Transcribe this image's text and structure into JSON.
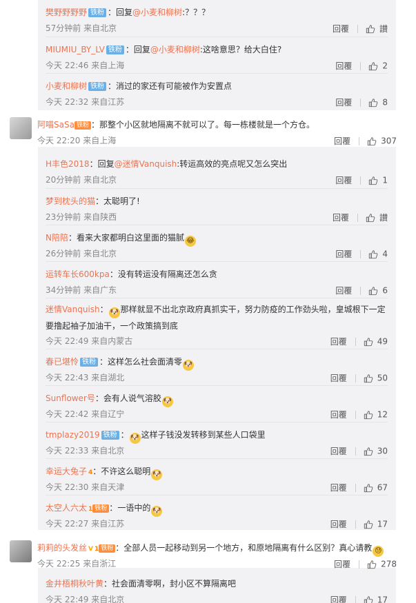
{
  "replies_top": [
    {
      "user": "樊野野野野",
      "badge": "铁粉",
      "sep": "：",
      "text_pre": "回复",
      "at": "@小麦和柳树",
      "text": ":？？？",
      "time": "57分钟前 来自北京",
      "reply_label": "回覆",
      "likes": "",
      "likes_label": "讃"
    },
    {
      "user": "MIUMIU_BY_LV",
      "badge": "铁粉",
      "sep": "：",
      "text_pre": "回复",
      "at": "@小麦和柳树",
      "text": ":这啥意思？给大白住?",
      "time": "今天 22:46 来自上海",
      "reply_label": "回覆",
      "likes": "2"
    },
    {
      "user": "小麦和柳树",
      "badge": "铁粉",
      "sep": "：",
      "text_pre": "",
      "at": "",
      "text": "消过的家还有可能被作为安置点",
      "time": "今天 22:32 来自江苏",
      "reply_label": "回覆",
      "likes": "8"
    }
  ],
  "comment1": {
    "user": "阿喵SaSa",
    "badge": "铁粉",
    "sep": "：",
    "text": "那整个小区就地隔离不就可以了。每一栋楼就是一个方仓。",
    "time": "今天 22:20 来自上海",
    "reply_label": "回覆",
    "likes": "307"
  },
  "replies_mid": [
    {
      "user": "H丰色2018",
      "sep": "：",
      "text_pre": "回复",
      "at": "@迷情Vanquish",
      "text": ":转运高效的亮点呢又怎么突出",
      "time": "20分钟前 来自北京",
      "reply_label": "回覆",
      "likes": "1"
    },
    {
      "user": "梦到枕头的猫",
      "sep": "：",
      "text": "太聪明了!",
      "time": "23分钟前 来自陕西",
      "reply_label": "回覆",
      "likes": "",
      "likes_label": "讃"
    },
    {
      "user": "N陪陪",
      "sep": "：",
      "text": "看来大家都明白这里面的猫腻",
      "emoji_after": "😂",
      "time": "26分钟前 来自北京",
      "reply_label": "回覆",
      "likes": "4"
    },
    {
      "user": "运转车长600kpa",
      "sep": "：",
      "text": "没有转运没有隔离还怎么贪",
      "time": "34分钟前 来自广东",
      "reply_label": "回覆",
      "likes": "6"
    },
    {
      "user": "迷情Vanquish",
      "sep": "：",
      "emoji_before": "🐶",
      "text": "那样就显不出北京政府真抓实干，努力防疫的工作劲头啦，皇城根下一定要撸起袖子加油干，一个政策搞到底",
      "time": "今天 22:49 来自内蒙古",
      "reply_label": "回覆",
      "likes": "49",
      "two": true
    },
    {
      "user": "春已堪怜",
      "badge": "铁粉",
      "sep": "：",
      "text": "这样怎么社会面清零",
      "emoji_after": "🐶",
      "time": "今天 22:43 来自湖北",
      "reply_label": "回覆",
      "likes": "50"
    },
    {
      "user": "Sunflower号",
      "sep": "：",
      "text": "会有人说气溶胶",
      "emoji_after": "🐶",
      "time": "今天 22:42 来自辽宁",
      "reply_label": "回覆",
      "likes": "12"
    },
    {
      "user": "tmplazy2019",
      "badge": "铁粉",
      "sep": "：",
      "emoji_before": "🐶",
      "text": "这样子钱没发转移到某些人口袋里",
      "time": "今天 22:33 来自北京",
      "reply_label": "回覆",
      "likes": "30"
    },
    {
      "user": "幸运大兔子",
      "vip": "4",
      "sep": "：",
      "text": "不许这么聪明",
      "emoji_after": "🐶",
      "time": "今天 22:30 来自天津",
      "reply_label": "回覆",
      "likes": "67"
    },
    {
      "user": "太空人六太",
      "vip": "1",
      "sbadge": "铁粉",
      "sep": "：",
      "text": "一语中的",
      "emoji_after": "🐶",
      "time": "今天 22:27 来自江苏",
      "reply_label": "回覆",
      "likes": "17"
    }
  ],
  "comment2": {
    "user": "莉莉的头发丝",
    "verified": "V",
    "vip": "1",
    "badge": "铁粉",
    "sep": "：",
    "text": "全部人员一起移动到另一个地方，和原地隔离有什么区别？真心请教",
    "emoji_after": "😓",
    "time": "今天 22:25 来自浙江",
    "reply_label": "回覆",
    "likes": "278"
  },
  "replies_bottom": [
    {
      "user": "金井梧桐秋叶黄",
      "sep": "：",
      "text": "社会面清零啊，封小区不算隔离吧",
      "time": "今天 22:49 来自北京",
      "reply_label": "回覆",
      "likes": "17"
    }
  ],
  "colors": {
    "username": "#eb7350",
    "badge": "#6ab0e6",
    "reply_bg": "#f2f2f5"
  },
  "icons": {
    "like": "thumbs-up-icon",
    "emoji": "dog-face-emoji"
  }
}
